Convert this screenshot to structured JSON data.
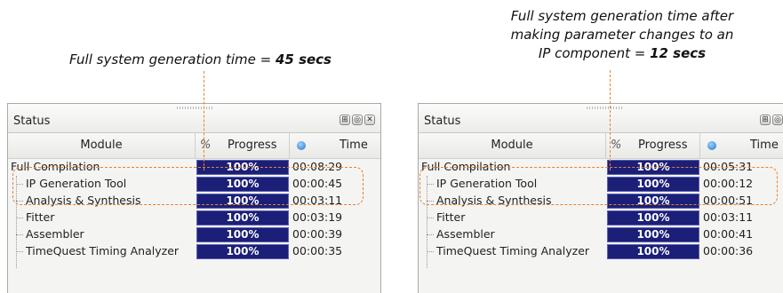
{
  "captions": {
    "left_text": "Full system generation time = ",
    "left_value": "45 secs",
    "right_line1": "Full system generation time after",
    "right_line2": "making parameter changes to an",
    "right_line3_text": "IP component = ",
    "right_value": "12 secs"
  },
  "panels": [
    {
      "title": "Status",
      "header_icons": [
        "pin-icon",
        "restore-icon",
        "close-icon"
      ],
      "columns": {
        "module": "Module",
        "progress_icon": "%",
        "progress": "Progress",
        "time": "Time"
      },
      "rows": [
        {
          "module": "Full Compilation",
          "progress": "100%",
          "time": "00:08:29"
        },
        {
          "module": "IP Generation Tool",
          "progress": "100%",
          "time": "00:00:45"
        },
        {
          "module": "Analysis & Synthesis",
          "progress": "100%",
          "time": "00:03:11"
        },
        {
          "module": "Fitter",
          "progress": "100%",
          "time": "00:03:19"
        },
        {
          "module": "Assembler",
          "progress": "100%",
          "time": "00:00:39"
        },
        {
          "module": "TimeQuest Timing Analyzer",
          "progress": "100%",
          "time": "00:00:35"
        }
      ]
    },
    {
      "title": "Status",
      "header_icons": [
        "pin-icon",
        "restore-icon",
        "close-icon"
      ],
      "columns": {
        "module": "Module",
        "progress_icon": "%",
        "progress": "Progress",
        "time": "Time"
      },
      "rows": [
        {
          "module": "Full Compilation",
          "progress": "100%",
          "time": "00:05:31"
        },
        {
          "module": "IP Generation Tool",
          "progress": "100%",
          "time": "00:00:12"
        },
        {
          "module": "Analysis & Synthesis",
          "progress": "100%",
          "time": "00:00:51"
        },
        {
          "module": "Fitter",
          "progress": "100%",
          "time": "00:03:11"
        },
        {
          "module": "Assembler",
          "progress": "100%",
          "time": "00:00:41"
        },
        {
          "module": "TimeQuest Timing Analyzer",
          "progress": "100%",
          "time": "00:00:36"
        }
      ]
    }
  ],
  "colors": {
    "highlight": "#e8822b",
    "progress_bar": "#1b1f78"
  }
}
